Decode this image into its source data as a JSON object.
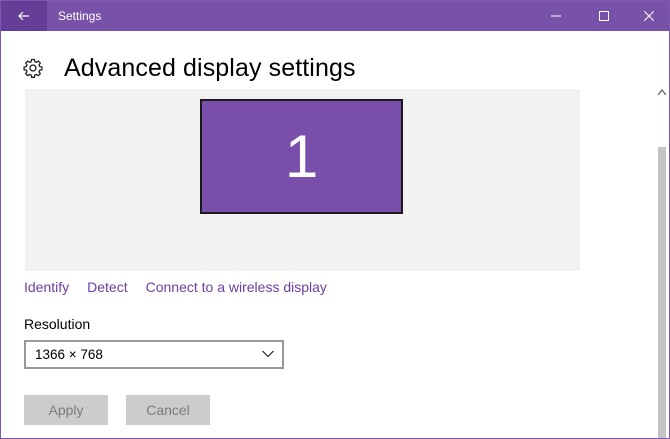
{
  "window": {
    "title": "Settings"
  },
  "header": {
    "title": "Advanced display settings",
    "icon": "gear-icon"
  },
  "display": {
    "monitor_number": "1",
    "accent_color": "#7a4fab"
  },
  "links": {
    "identify": "Identify",
    "detect": "Detect",
    "connect_wireless": "Connect to a wireless display"
  },
  "resolution": {
    "label": "Resolution",
    "selected": "1366 × 768"
  },
  "buttons": {
    "apply": "Apply",
    "cancel": "Cancel"
  },
  "colors": {
    "titlebar": "#7851a9",
    "link": "#6b3fa4"
  }
}
